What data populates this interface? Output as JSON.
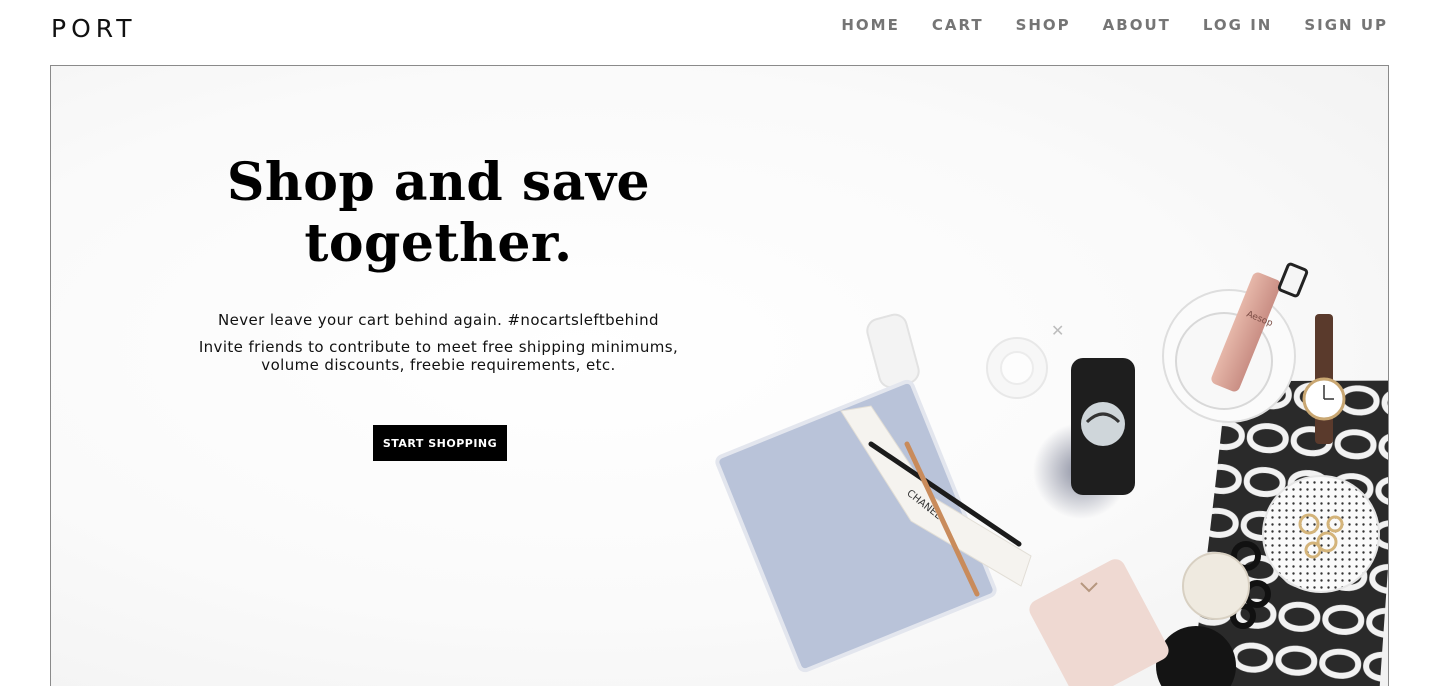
{
  "header": {
    "logo": "PORT",
    "nav": [
      {
        "label": "HOME"
      },
      {
        "label": "CART"
      },
      {
        "label": "SHOP"
      },
      {
        "label": "ABOUT"
      },
      {
        "label": "LOG IN"
      },
      {
        "label": "SIGN UP"
      }
    ]
  },
  "hero": {
    "headline_line1": "Shop and save",
    "headline_line2": "together.",
    "tagline": "Never leave your cart behind again. #nocartsleftbehind",
    "desc_line1": "Invite friends to contribute to meet free shipping minimums,",
    "desc_line2": "volume discounts, freebie requirements, etc.",
    "cta_label": "START SHOPPING",
    "photo": {
      "notebook_ribbon_text": "CHANEL",
      "bottle_label_text": "Aesop"
    }
  },
  "colors": {
    "accent": "#000000",
    "nav_text": "#757575",
    "notebook": "#b9c3d9",
    "pouch": "#efd9d2"
  }
}
